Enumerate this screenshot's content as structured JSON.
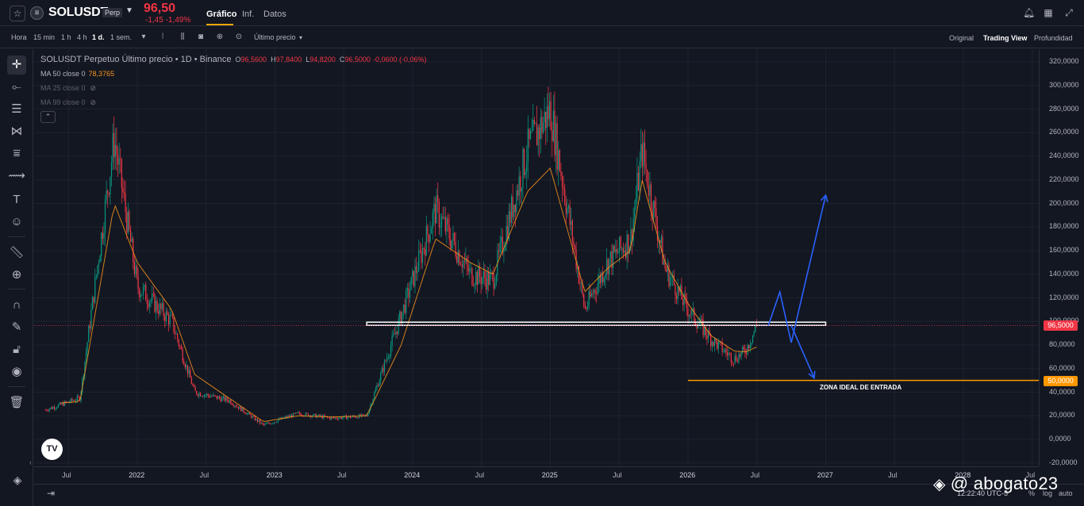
{
  "header": {
    "symbol": "SOLUSDT",
    "badge": "Perp",
    "price": "96,50",
    "change": "-1,45  -1,49%",
    "tabs": [
      "Gráfico",
      "Inf.",
      "Datos"
    ]
  },
  "toolbar": {
    "timeframes": [
      "Hora",
      "15 min",
      "1 h",
      "4 h",
      "1 d.",
      "1 sem."
    ],
    "active_timeframe": "1 d.",
    "price_type": "Último precio",
    "views": [
      "Original",
      "Trading View",
      "Profundidad"
    ],
    "active_view": "Trading View"
  },
  "legend": {
    "title": "SOLUSDT Perpetuo Último precio • 1D • Binance",
    "open_label": "O",
    "open": "96,5600",
    "high_label": "H",
    "high": "97,8400",
    "low_label": "L",
    "low": "94,8200",
    "close_label": "C",
    "close": "96,5000",
    "change": "-0,0600 (-0,06%)",
    "ma50": "MA 50 close 0",
    "ma50_value": "78,3765",
    "ma25": "MA 25 close 0",
    "ma99": "MA 99 close 0"
  },
  "annotations": {
    "zone_label": "ZONA IDEAL DE ENTRADA",
    "current_price_tag": "96,5000",
    "zone_price_tag": "50,0000"
  },
  "price_axis": [
    "320,0000",
    "300,0000",
    "280,0000",
    "260,0000",
    "240,0000",
    "220,0000",
    "200,0000",
    "180,0000",
    "160,0000",
    "140,0000",
    "120,0000",
    "100,0000",
    "80,0000",
    "60,0000",
    "40,0000",
    "20,0000",
    "0,0000",
    "-20,0000"
  ],
  "time_axis": [
    "Jul",
    "2022",
    "Jul",
    "2023",
    "Jul",
    "2024",
    "Jul",
    "2025",
    "Jul",
    "2026",
    "Jul",
    "2027",
    "Jul",
    "2028",
    "Jul"
  ],
  "bottom": {
    "clock": "12:22:40 UTC-5",
    "percent": "%",
    "log": "log",
    "auto": "auto"
  },
  "watermark": "@ abogato23",
  "colors": {
    "background": "#131722",
    "down": "#f23645",
    "up": "#089981",
    "ma_line": "#f7931a",
    "projection": "#2962ff",
    "zone_line": "#ff9800",
    "support_line": "#ffffff"
  },
  "chart_data": {
    "type": "candlestick",
    "title": "SOLUSDT Perpetuo Último precio • 1D • Binance",
    "ylim": [
      -20,
      330
    ],
    "price_ticks": [
      320,
      300,
      280,
      260,
      240,
      220,
      200,
      180,
      160,
      140,
      120,
      100,
      80,
      60,
      40,
      20,
      0,
      -20
    ],
    "x_ticks": [
      "Jul",
      "2022",
      "Jul",
      "2023",
      "Jul",
      "2024",
      "Jul",
      "2025",
      "Jul",
      "2026",
      "Jul",
      "2027",
      "Jul",
      "2028",
      "Jul"
    ],
    "series": [
      {
        "name": "SOLUSDT",
        "x": [
          "2021-05",
          "2021-08",
          "2021-11",
          "2022-01",
          "2022-04",
          "2022-06",
          "2022-09",
          "2022-12",
          "2023-03",
          "2023-06",
          "2023-09",
          "2023-12",
          "2024-03",
          "2024-06",
          "2024-08",
          "2024-11",
          "2025-01",
          "2025-04",
          "2025-06",
          "2025-08",
          "2025-09",
          "2025-11",
          "2026-01",
          "2026-03",
          "2026-05",
          "2026-06",
          "2026-07"
        ],
        "values": [
          25,
          35,
          255,
          130,
          100,
          40,
          33,
          12,
          22,
          18,
          20,
          105,
          195,
          140,
          135,
          245,
          280,
          110,
          150,
          170,
          245,
          145,
          110,
          85,
          68,
          75,
          96.5
        ]
      },
      {
        "name": "MA 50 close 0",
        "values": [
          30,
          32,
          200,
          150,
          110,
          55,
          35,
          15,
          20,
          19,
          20,
          80,
          170,
          150,
          140,
          210,
          230,
          125,
          145,
          160,
          220,
          150,
          115,
          88,
          75,
          74,
          78.3765
        ]
      }
    ],
    "lines": [
      {
        "name": "support",
        "price": 98,
        "from": "2023-09",
        "to": "2027-01"
      },
      {
        "name": "ZONA IDEAL DE ENTRADA",
        "price": 50,
        "from": "2026-01",
        "to": "2028-08"
      }
    ],
    "projection_up": [
      {
        "x": "2026-08",
        "y": 96.5
      },
      {
        "x": "2026-09",
        "y": 125
      },
      {
        "x": "2026-10",
        "y": 82
      },
      {
        "x": "2027-01",
        "y": 207
      }
    ],
    "projection_down": [
      {
        "x": "2026-10",
        "y": 96.5
      },
      {
        "x": "2026-12",
        "y": 52
      }
    ]
  }
}
